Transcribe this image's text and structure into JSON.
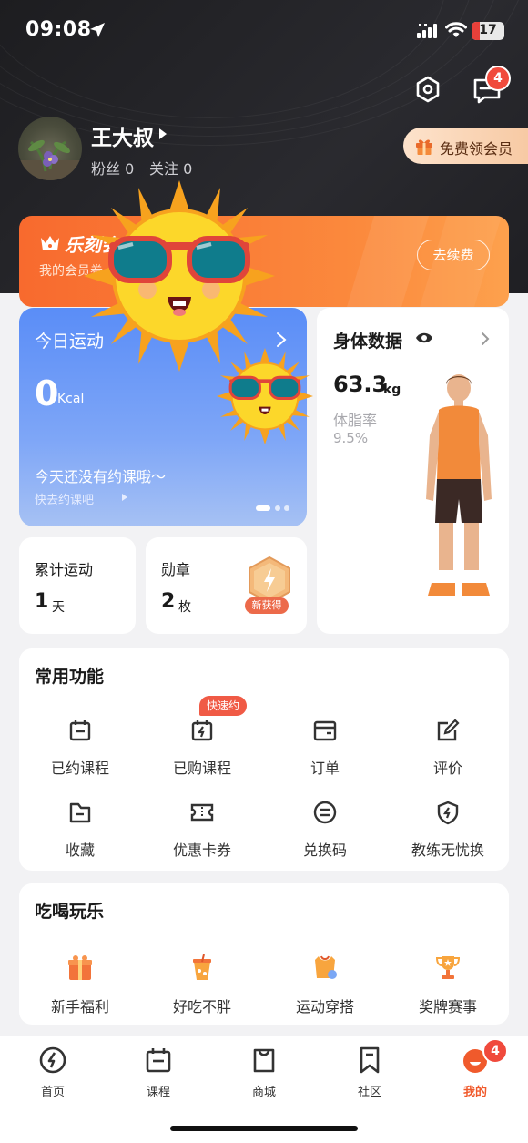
{
  "status_bar": {
    "time": "09:08",
    "battery": "17"
  },
  "header": {
    "msg_badge": "4"
  },
  "profile": {
    "username": "王大叔",
    "fans": "粉丝 0",
    "follows": "关注 0"
  },
  "vip": {
    "label": "免费领会员"
  },
  "member_card": {
    "brand": "乐刻会",
    "desc": "我的会员卷",
    "renew": "去续费"
  },
  "sport": {
    "title": "今日运动",
    "value": "0",
    "unit": "Kcal",
    "message": "今天还没有约课哦～",
    "link": "快去约课吧"
  },
  "body_data": {
    "title": "身体数据",
    "weight": "63.3",
    "weight_unit": "kg",
    "fat_label": "体脂率",
    "fat_value": "9.5%"
  },
  "stats": [
    {
      "label": "累计运动",
      "value": "1",
      "unit": "天"
    },
    {
      "label": "勋章",
      "value": "2",
      "unit": "枚",
      "medal_tag": "新获得"
    }
  ],
  "functions": {
    "title": "常用功能",
    "quick_tag": "快速约",
    "items": [
      "已约课程",
      "已购课程",
      "订单",
      "评价",
      "收藏",
      "优惠卡券",
      "兑换码",
      "教练无忧换"
    ]
  },
  "fun": {
    "title": "吃喝玩乐",
    "items": [
      "新手福利",
      "好吃不胖",
      "运动穿搭",
      "奖牌赛事"
    ]
  },
  "tabs": [
    "首页",
    "课程",
    "商城",
    "社区",
    "我的"
  ],
  "tab_badge": "4",
  "colors": {
    "accent": "#f05a2c",
    "sport_card": "#5a8df7",
    "badge": "#f04a3c"
  }
}
